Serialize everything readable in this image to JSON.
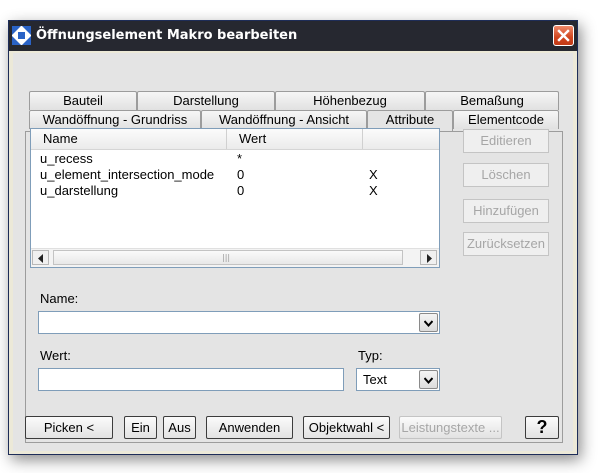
{
  "window": {
    "title": "Öffnungselement Makro bearbeiten",
    "icon": "app-icon",
    "close_icon": "close-icon"
  },
  "tabs": {
    "row1": [
      "Bauteil",
      "Darstellung",
      "Höhenbezug",
      "Bemaßung"
    ],
    "row2": [
      "Wandöffnung - Grundriss",
      "Wandöffnung - Ansicht",
      "Attribute",
      "Elementcode"
    ],
    "active": "Attribute"
  },
  "list": {
    "columns": [
      "Name",
      "Wert",
      ""
    ],
    "rows": [
      {
        "name": "u_recess",
        "value": "*",
        "flag": ""
      },
      {
        "name": "u_element_intersection_mode",
        "value": "0",
        "flag": "X"
      },
      {
        "name": "u_darstellung",
        "value": "0",
        "flag": "X"
      }
    ],
    "scroll_grip": "|||"
  },
  "side_buttons": [
    "Editieren",
    "Löschen",
    "Hinzufügen",
    "Zurücksetzen"
  ],
  "fields": {
    "name_label": "Name:",
    "name_value": "",
    "wert_label": "Wert:",
    "wert_value": "",
    "typ_label": "Typ:",
    "typ_value": "Text"
  },
  "footer": {
    "picken": "Picken <",
    "ein": "Ein",
    "aus": "Aus",
    "anwenden": "Anwenden",
    "objektwahl": "Objektwahl <",
    "leistungstexte": "Leistungstexte ...",
    "help": "?"
  },
  "colors": {
    "titlebar": "#262830",
    "close": "#d0461f",
    "dialog": "#e4e4e4"
  }
}
